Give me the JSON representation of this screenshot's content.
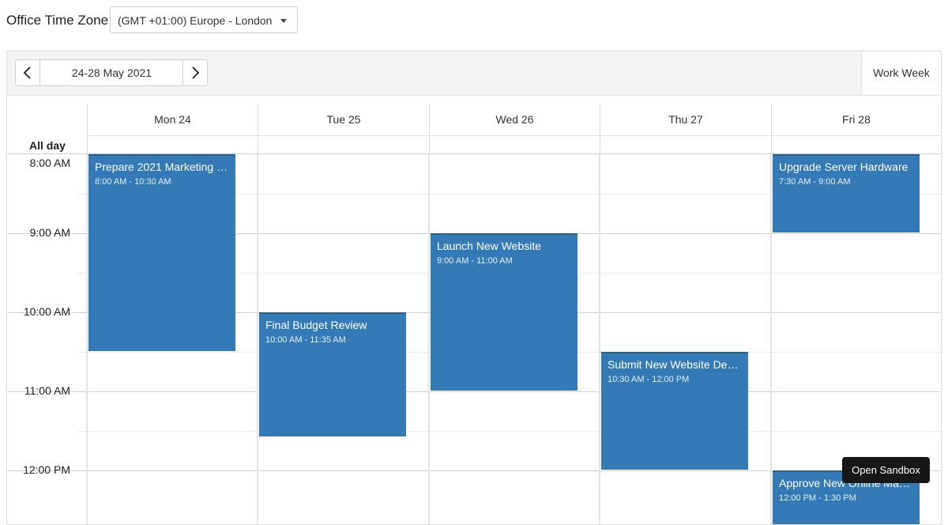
{
  "timezone": {
    "label": "Office Time Zone",
    "selected": "(GMT +01:00) Europe - London"
  },
  "toolbar": {
    "date_range": "24-28 May 2021",
    "view": "Work Week"
  },
  "days": [
    "Mon 24",
    "Tue 25",
    "Wed 26",
    "Thu 27",
    "Fri 28"
  ],
  "allday_label": "All day",
  "hours": [
    "8:00 AM",
    "9:00 AM",
    "10:00 AM",
    "11:00 AM",
    "12:00 PM"
  ],
  "events": [
    {
      "title": "Prepare 2021 Marketing P...",
      "time": "8:00 AM - 10:30 AM"
    },
    {
      "title": "Final Budget Review",
      "time": "10:00 AM - 11:35 AM"
    },
    {
      "title": "Launch New Website",
      "time": "9:00 AM - 11:00 AM"
    },
    {
      "title": "Submit New Website Desi...",
      "time": "10:30 AM - 12:00 PM"
    },
    {
      "title": "Upgrade Server Hardware",
      "time": "7:30 AM - 9:00 AM"
    },
    {
      "title": "Approve New Online Marketi...",
      "time": "12:00 PM - 1:30 PM"
    }
  ],
  "sandbox_button": "Open Sandbox",
  "colors": {
    "event": "#337ab7",
    "event_border": "#2a5f8e"
  },
  "icons": {
    "prev": "chevron-left-icon",
    "next": "chevron-right-icon",
    "dropdown": "caret-down-icon"
  }
}
